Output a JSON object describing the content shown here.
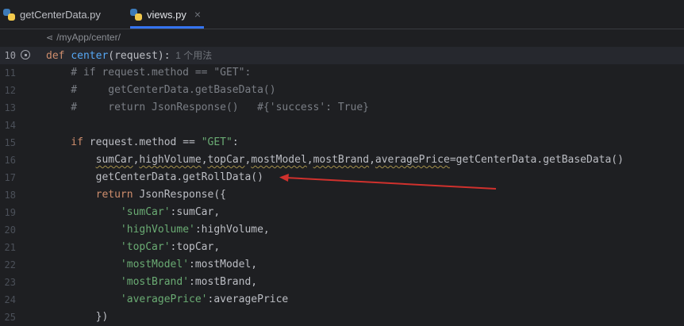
{
  "tabs": [
    {
      "label": "getCenterData.py",
      "active": false
    },
    {
      "label": "views.py",
      "active": true
    }
  ],
  "tab_close_glyph": "×",
  "breadcrumb": {
    "path": "/myApp/center/"
  },
  "editor": {
    "usage_hint": "1 个用法",
    "lines": [
      {
        "num": "10",
        "tokens": [
          [
            "kw",
            "def "
          ],
          [
            "fn",
            "center"
          ],
          [
            "pn",
            "(request):"
          ]
        ]
      },
      {
        "num": "11",
        "tokens": [
          [
            "cm",
            "    # if request.method == \"GET\":"
          ]
        ]
      },
      {
        "num": "12",
        "tokens": [
          [
            "cm",
            "    #     getCenterData.getBaseData()"
          ]
        ]
      },
      {
        "num": "13",
        "tokens": [
          [
            "cm",
            "    #     return JsonResponse()   #{'success': True}"
          ]
        ]
      },
      {
        "num": "14",
        "tokens": []
      },
      {
        "num": "15",
        "tokens": [
          [
            "kw",
            "    if "
          ],
          [
            "pn",
            "request.method == "
          ],
          [
            "str",
            "\"GET\""
          ],
          [
            "pn",
            ":"
          ]
        ]
      },
      {
        "num": "16",
        "tokens": [
          [
            "pn",
            "        "
          ],
          [
            "sq",
            "sumCar"
          ],
          [
            "pn",
            ","
          ],
          [
            "sq",
            "highVolume"
          ],
          [
            "pn",
            ","
          ],
          [
            "sq",
            "topCar"
          ],
          [
            "pn",
            ","
          ],
          [
            "sq",
            "mostModel"
          ],
          [
            "pn",
            ","
          ],
          [
            "sq",
            "mostBrand"
          ],
          [
            "pn",
            ","
          ],
          [
            "sq",
            "averagePrice"
          ],
          [
            "pn",
            "=getCenterData.getBaseData()"
          ]
        ]
      },
      {
        "num": "17",
        "tokens": [
          [
            "pn",
            "        getCenterData.getRollData()"
          ]
        ]
      },
      {
        "num": "18",
        "tokens": [
          [
            "kw",
            "        return "
          ],
          [
            "pn",
            "JsonResponse({"
          ]
        ]
      },
      {
        "num": "19",
        "tokens": [
          [
            "pn",
            "            "
          ],
          [
            "str",
            "'sumCar'"
          ],
          [
            "pn",
            ":sumCar,"
          ]
        ]
      },
      {
        "num": "20",
        "tokens": [
          [
            "pn",
            "            "
          ],
          [
            "str",
            "'highVolume'"
          ],
          [
            "pn",
            ":highVolume,"
          ]
        ]
      },
      {
        "num": "21",
        "tokens": [
          [
            "pn",
            "            "
          ],
          [
            "str",
            "'topCar'"
          ],
          [
            "pn",
            ":topCar,"
          ]
        ]
      },
      {
        "num": "22",
        "tokens": [
          [
            "pn",
            "            "
          ],
          [
            "str",
            "'mostModel'"
          ],
          [
            "pn",
            ":mostModel,"
          ]
        ]
      },
      {
        "num": "23",
        "tokens": [
          [
            "pn",
            "            "
          ],
          [
            "str",
            "'mostBrand'"
          ],
          [
            "pn",
            ":mostBrand,"
          ]
        ]
      },
      {
        "num": "24",
        "tokens": [
          [
            "pn",
            "            "
          ],
          [
            "str",
            "'averagePrice'"
          ],
          [
            "pn",
            ":averagePrice"
          ]
        ]
      },
      {
        "num": "25",
        "tokens": [
          [
            "pn",
            "        })"
          ]
        ]
      }
    ]
  },
  "colors": {
    "arrow": "#d0312d",
    "accent": "#3574f0"
  },
  "icons": {
    "tab_file": "python-icon",
    "breadcrumb": "route-icon",
    "gutter": "endpoint-icon"
  }
}
